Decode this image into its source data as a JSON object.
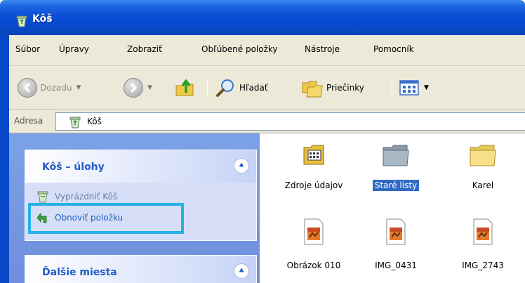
{
  "window": {
    "title": "Kôš"
  },
  "menu": [
    "Súbor",
    "Úpravy",
    "Zobraziť",
    "Obľúbené položky",
    "Nástroje",
    "Pomocník"
  ],
  "toolbar": {
    "back_label": "Dozadu",
    "search_label": "Hľadať",
    "folders_label": "Priečinky"
  },
  "address": {
    "label": "Adresa",
    "value": "Kôš"
  },
  "taskpane": {
    "tasks_panel": {
      "title": "Kôš – úlohy",
      "items": [
        {
          "label": "Vyprázdniť Kôš",
          "icon": "empty-recycle-bin-icon",
          "enabled": false
        },
        {
          "label": "Obnoviť položku",
          "icon": "restore-icon",
          "enabled": true
        }
      ]
    },
    "other_places": {
      "title": "Ďalšie miesta"
    }
  },
  "files": [
    {
      "name": "Zdroje údajov",
      "icon": "data-source-folder-icon",
      "selected": false
    },
    {
      "name": "Staré listy",
      "icon": "folder-icon-gray",
      "selected": true
    },
    {
      "name": "Karel",
      "icon": "folder-icon",
      "selected": false
    },
    {
      "name": "Obrázok 010",
      "icon": "image-file-icon",
      "selected": false
    },
    {
      "name": "IMG_0431",
      "icon": "image-file-icon",
      "selected": false
    },
    {
      "name": "IMG_2743",
      "icon": "image-file-icon",
      "selected": false
    }
  ],
  "colors": {
    "titlebar": "#0a4fd6",
    "taskpane": "#7ba2e7",
    "panel_title": "#215dc6",
    "selection": "#316ac5",
    "highlight": "#24b2e6"
  }
}
